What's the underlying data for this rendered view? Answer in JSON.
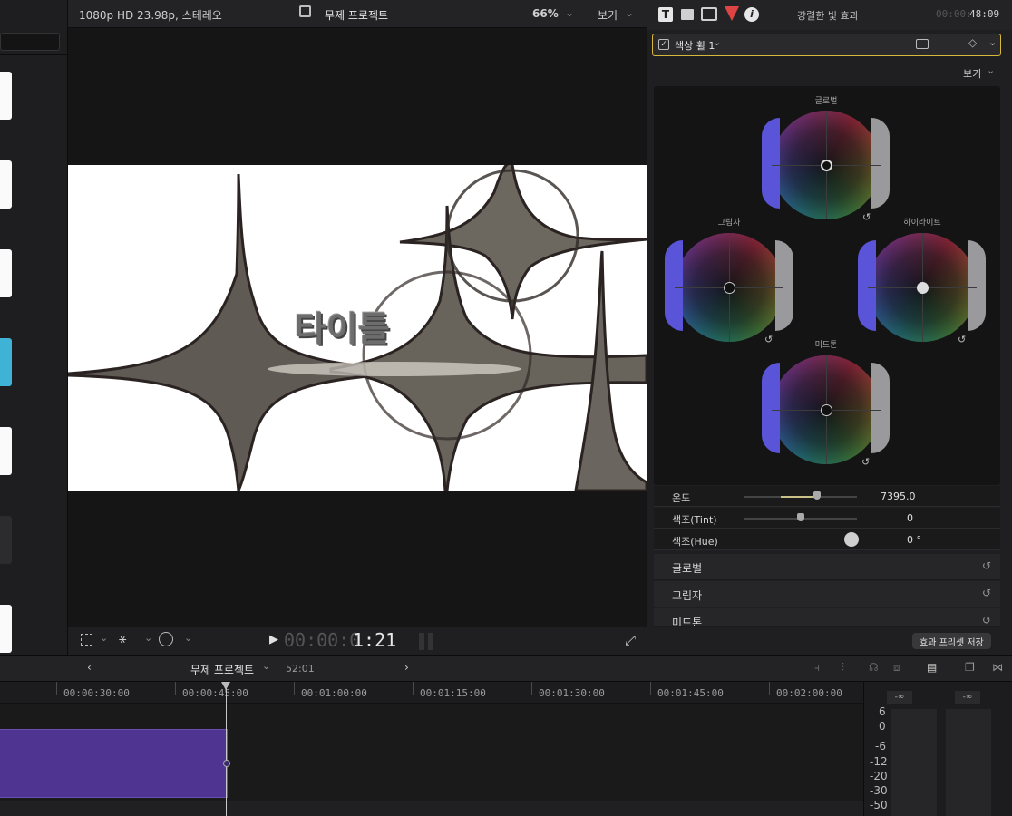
{
  "viewer": {
    "format": "1080p HD 23.98p, 스테레오",
    "project_title": "무제 프로젝트",
    "zoom": "66%",
    "view_label": "보기",
    "title_overlay": "타이틀",
    "timecode_dim": "00:00:0",
    "timecode_bright": "1:21"
  },
  "inspector": {
    "section_title": "강렬한 빛 효과",
    "timecode_dim": "00:00:",
    "timecode_bright": "48:09",
    "effect_name": "색상 휠 1",
    "view_label": "보기",
    "wheels": {
      "global": "글로벌",
      "shadows": "그림자",
      "highlights": "하이라이트",
      "midtones": "미드톤"
    },
    "params": [
      {
        "label": "온도",
        "value": "7395.0"
      },
      {
        "label": "색조(Tint)",
        "value": "0"
      },
      {
        "label": "색조(Hue)",
        "value": "0 °"
      }
    ],
    "sections": [
      "글로벌",
      "그림자",
      "미드톤"
    ],
    "save_preset": "효과 프리셋 저장"
  },
  "timeline": {
    "project_name": "무제 프로젝트",
    "duration": "52:01",
    "ruler": [
      "00:00:30:00",
      "00:00:45:00",
      "00:01:00:00",
      "00:01:15:00",
      "00:01:30:00",
      "00:01:45:00",
      "00:02:00:00"
    ],
    "meter_peak_left": "-∞",
    "meter_peak_right": "-∞",
    "meter_scale": [
      "6",
      "0",
      "-6",
      "-12",
      "-20",
      "-30",
      "-50"
    ]
  },
  "colors": {
    "accent_selection": "#d6b83a",
    "clip_purple": "#4f3491",
    "thumb_cyan": "#3eb3d6"
  }
}
